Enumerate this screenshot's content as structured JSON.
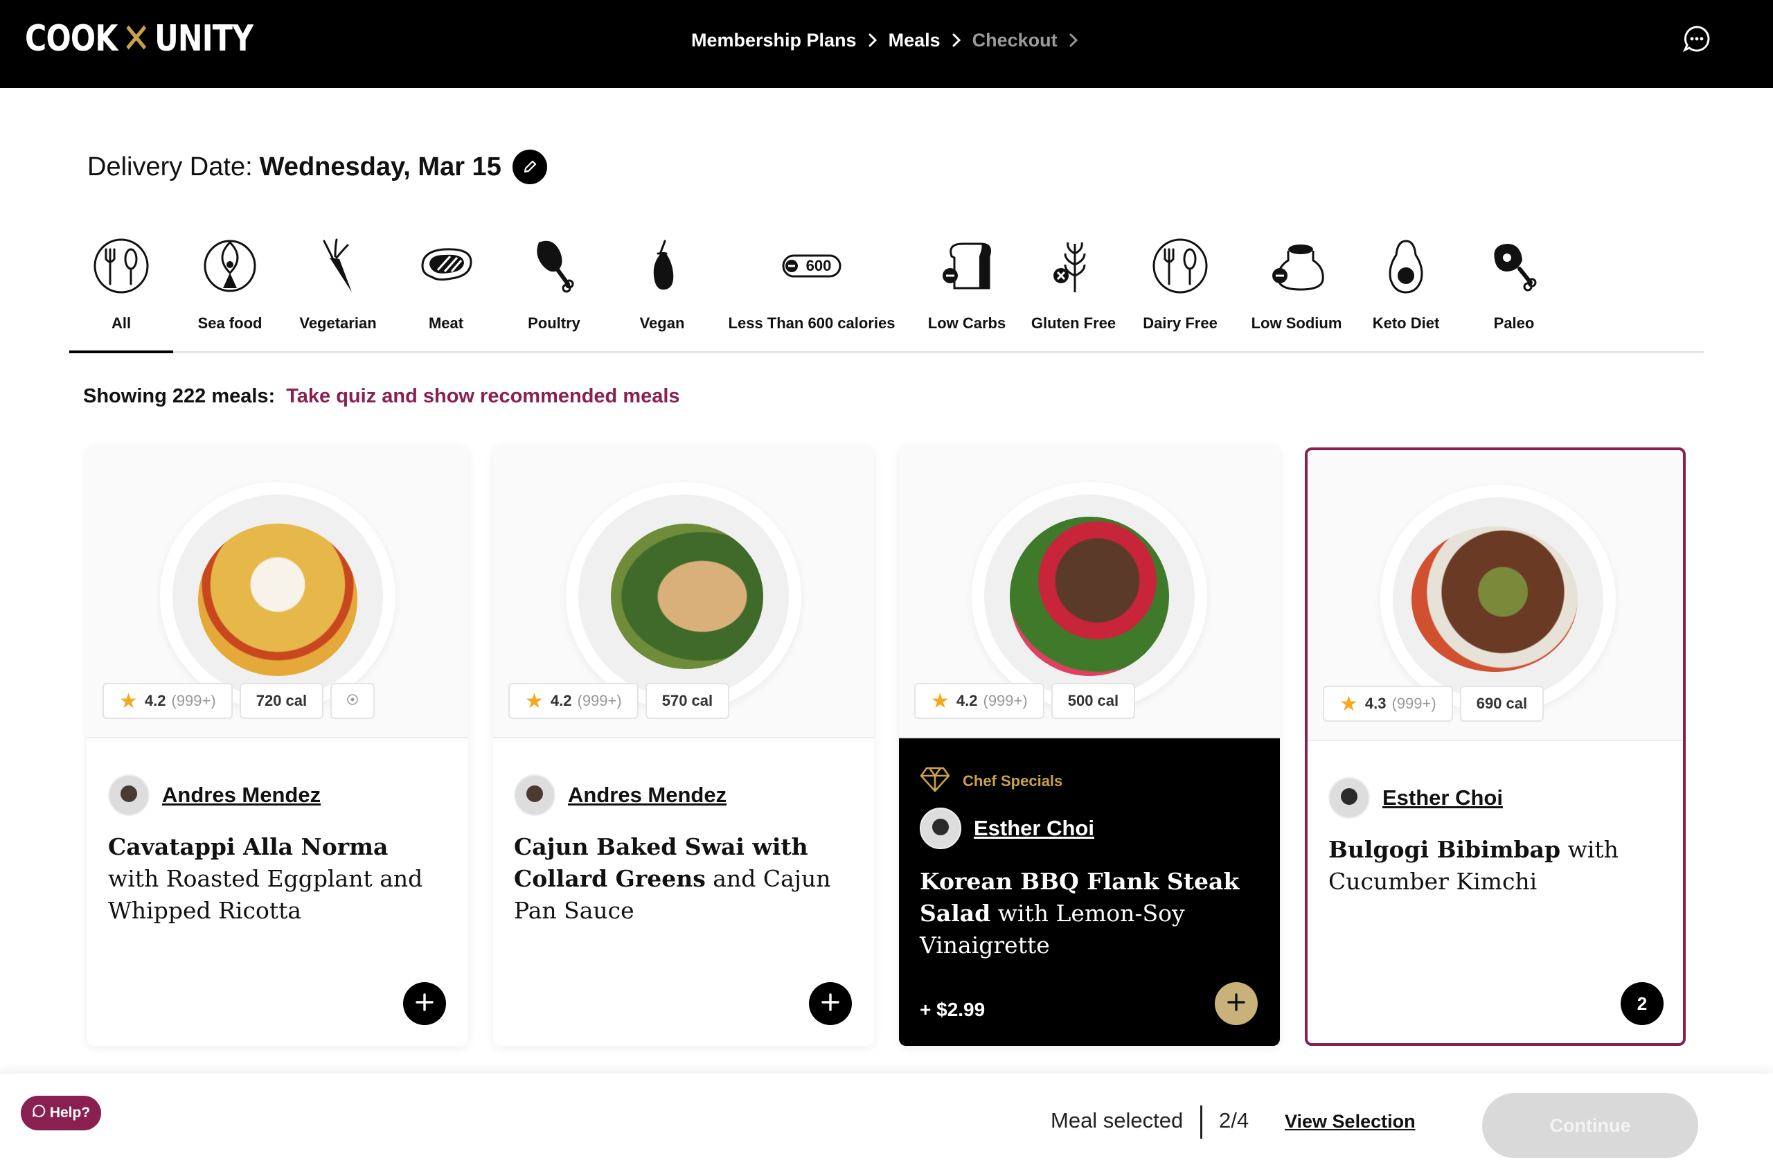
{
  "brand": {
    "left": "COOK",
    "mark": "✕",
    "right": "UNITY"
  },
  "breadcrumbs": [
    {
      "label": "Membership Plans",
      "state": "complete"
    },
    {
      "label": "Meals",
      "state": "current"
    },
    {
      "label": "Checkout",
      "state": "upcoming"
    }
  ],
  "delivery": {
    "label": "Delivery Date:",
    "date": "Wednesday, Mar 15"
  },
  "filters": [
    {
      "label": "All",
      "icon": "utensils-plate-icon",
      "active": true
    },
    {
      "label": "Sea food",
      "icon": "fish-icon"
    },
    {
      "label": "Vegetarian",
      "icon": "carrot-icon"
    },
    {
      "label": "Meat",
      "icon": "steak-icon"
    },
    {
      "label": "Poultry",
      "icon": "drumstick-icon"
    },
    {
      "label": "Vegan",
      "icon": "eggplant-icon"
    },
    {
      "label": "Less Than 600 calories",
      "icon": "calories-600-icon",
      "badge": "600"
    },
    {
      "label": "Low Carbs",
      "icon": "bread-minus-icon"
    },
    {
      "label": "Gluten Free",
      "icon": "wheat-free-icon"
    },
    {
      "label": "Dairy Free",
      "icon": "dairy-free-icon"
    },
    {
      "label": "Low Sodium",
      "icon": "salt-minus-icon"
    },
    {
      "label": "Keto Diet",
      "icon": "avocado-icon"
    },
    {
      "label": "Paleo",
      "icon": "ham-leg-icon"
    }
  ],
  "showing": {
    "text": "Showing 222 meals:",
    "quiz_link": "Take quiz and show recommended meals"
  },
  "meals": [
    {
      "rating": "4.2",
      "reviews": "(999+)",
      "calories": "720 cal",
      "chef": "Andres Mendez",
      "title_bold": "Cavatappi Alla Norma",
      "title_rest": " with Roasted Eggplant and Whipped Ricotta"
    },
    {
      "rating": "4.2",
      "reviews": "(999+)",
      "calories": "570 cal",
      "chef": "Andres Mendez",
      "title_bold": "Cajun Baked Swai with Collard Greens",
      "title_rest": " and Cajun Pan Sauce"
    },
    {
      "rating": "4.2",
      "reviews": "(999+)",
      "calories": "500 cal",
      "badge": "Chef Specials",
      "chef": "Esther Choi",
      "title_bold": "Korean BBQ Flank Steak Salad",
      "title_rest": " with Lemon-Soy Vinaigrette",
      "price": "+ $2.99"
    },
    {
      "rating": "4.3",
      "reviews": "(999+)",
      "calories": "690 cal",
      "chef": "Esther Choi",
      "title_bold": "Bulgogi Bibimbap",
      "title_rest": " with Cucumber Kimchi",
      "quantity": "2"
    }
  ],
  "help": {
    "label": "Help?"
  },
  "footer": {
    "meal_selected": "Meal selected",
    "count": "2/4",
    "view_selection": "View Selection",
    "continue": "Continue"
  },
  "colors": {
    "accent": "#8a1f52",
    "gold": "#c9a24a",
    "star": "#f2a91d"
  }
}
